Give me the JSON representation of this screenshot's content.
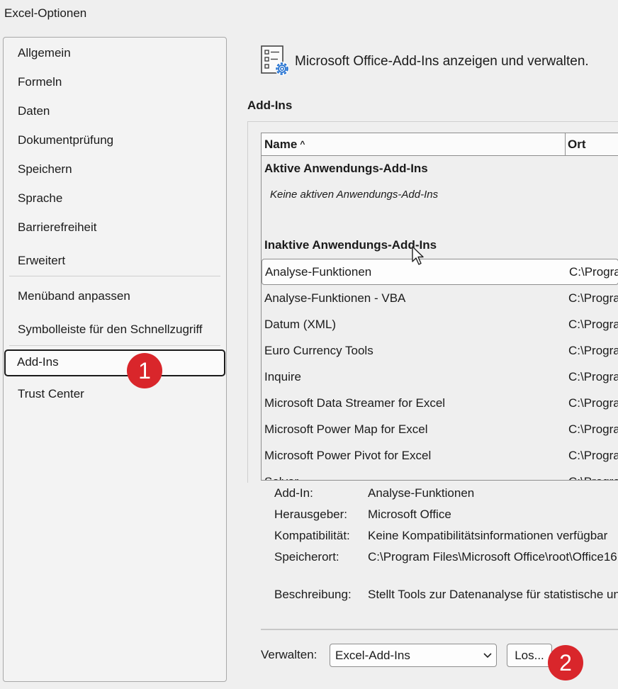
{
  "window": {
    "title": "Excel-Optionen"
  },
  "sidebar": {
    "items": [
      {
        "label": "Allgemein"
      },
      {
        "label": "Formeln"
      },
      {
        "label": "Daten"
      },
      {
        "label": "Dokumentprüfung"
      },
      {
        "label": "Speichern"
      },
      {
        "label": "Sprache"
      },
      {
        "label": "Barrierefreiheit"
      },
      {
        "label": "Erweitert"
      },
      {
        "label": "Menüband anpassen"
      },
      {
        "label": "Symbolleiste für den Schnellzugriff"
      },
      {
        "label": "Add-Ins"
      },
      {
        "label": "Trust Center"
      }
    ],
    "active": "Add-Ins"
  },
  "annotations": {
    "badge_1": "1",
    "badge_2": "2",
    "color": "#d9262b"
  },
  "header": {
    "text": "Microsoft Office-Add-Ins anzeigen und verwalten.",
    "icon": "addins-settings-icon"
  },
  "section": {
    "title": "Add-Ins"
  },
  "grid": {
    "col_name": "Name",
    "col_ort": "Ort",
    "active_group": "Aktive Anwendungs-Add-Ins",
    "active_empty": "Keine aktiven Anwendungs-Add-Ins",
    "inactive_group": "Inaktive Anwendungs-Add-Ins",
    "rows": [
      {
        "name": "Analyse-Funktionen",
        "ort": "C:\\Progra"
      },
      {
        "name": "Analyse-Funktionen - VBA",
        "ort": "C:\\Progra"
      },
      {
        "name": "Datum (XML)",
        "ort": "C:\\Progra"
      },
      {
        "name": "Euro Currency Tools",
        "ort": "C:\\Progra"
      },
      {
        "name": "Inquire",
        "ort": "C:\\Progra"
      },
      {
        "name": "Microsoft Data Streamer for Excel",
        "ort": "C:\\Progra"
      },
      {
        "name": "Microsoft Power Map for Excel",
        "ort": "C:\\Progra"
      },
      {
        "name": "Microsoft Power Pivot for Excel",
        "ort": "C:\\Progra"
      },
      {
        "name": "Solver",
        "ort": "C:\\Progra"
      }
    ]
  },
  "details": {
    "addin_label": "Add-In:",
    "addin_value": "Analyse-Funktionen",
    "publisher_label": "Herausgeber:",
    "publisher_value": "Microsoft Office",
    "compat_label": "Kompatibilität:",
    "compat_value": "Keine Kompatibilitätsinformationen verfügbar",
    "location_label": "Speicherort:",
    "location_value": "C:\\Program Files\\Microsoft Office\\root\\Office16",
    "desc_label": "Beschreibung:",
    "desc_value": "Stellt Tools zur Datenanalyse für statistische und"
  },
  "manage": {
    "label": "Verwalten:",
    "selected": "Excel-Add-Ins",
    "go_label": "Los..."
  }
}
